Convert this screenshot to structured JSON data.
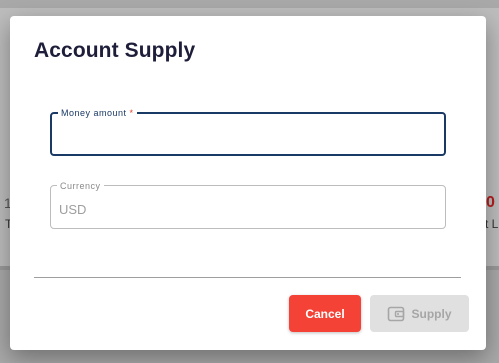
{
  "background": {
    "left_fragment_top": "1",
    "left_fragment_bottom": "T",
    "right_fragment_top": "0",
    "right_fragment_bottom": "t L"
  },
  "dialog": {
    "title": "Account Supply",
    "money_field": {
      "label": "Money amount",
      "required_mark": "*",
      "value": ""
    },
    "currency_field": {
      "label": "Currency",
      "value": "USD"
    },
    "actions": {
      "cancel_label": "Cancel",
      "supply_label": "Supply",
      "supply_icon": "wallet-icon"
    }
  },
  "colors": {
    "accent": "#1a3a66",
    "danger": "#f44336",
    "disabled_bg": "#e0e0e0",
    "disabled_text": "#a6a6a6"
  }
}
